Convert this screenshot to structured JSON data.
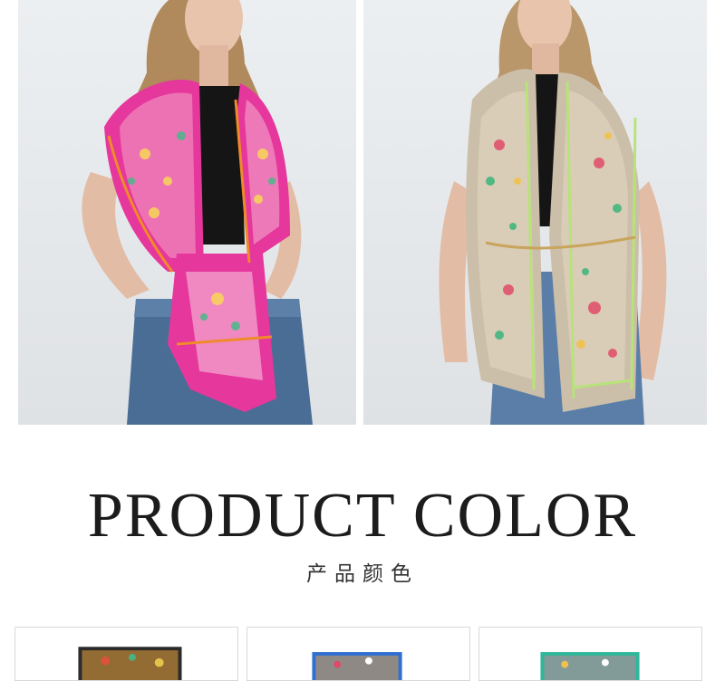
{
  "photos": [
    {
      "scarf_color": "#e5379c",
      "trim_color": "#f08a2a"
    },
    {
      "scarf_color": "#cbbfa9",
      "trim_color": "#b8e27a"
    }
  ],
  "section": {
    "title": "PRODUCT COLOR",
    "subtitle": "产品颜色"
  },
  "swatches": [
    {
      "main_color": "#2b2b2b",
      "accent_color": "#e9a23a"
    },
    {
      "main_color": "#2f6fd1",
      "accent_color": "#f0a43a"
    },
    {
      "main_color": "#2fb79a",
      "accent_color": "#e87a9a"
    }
  ]
}
